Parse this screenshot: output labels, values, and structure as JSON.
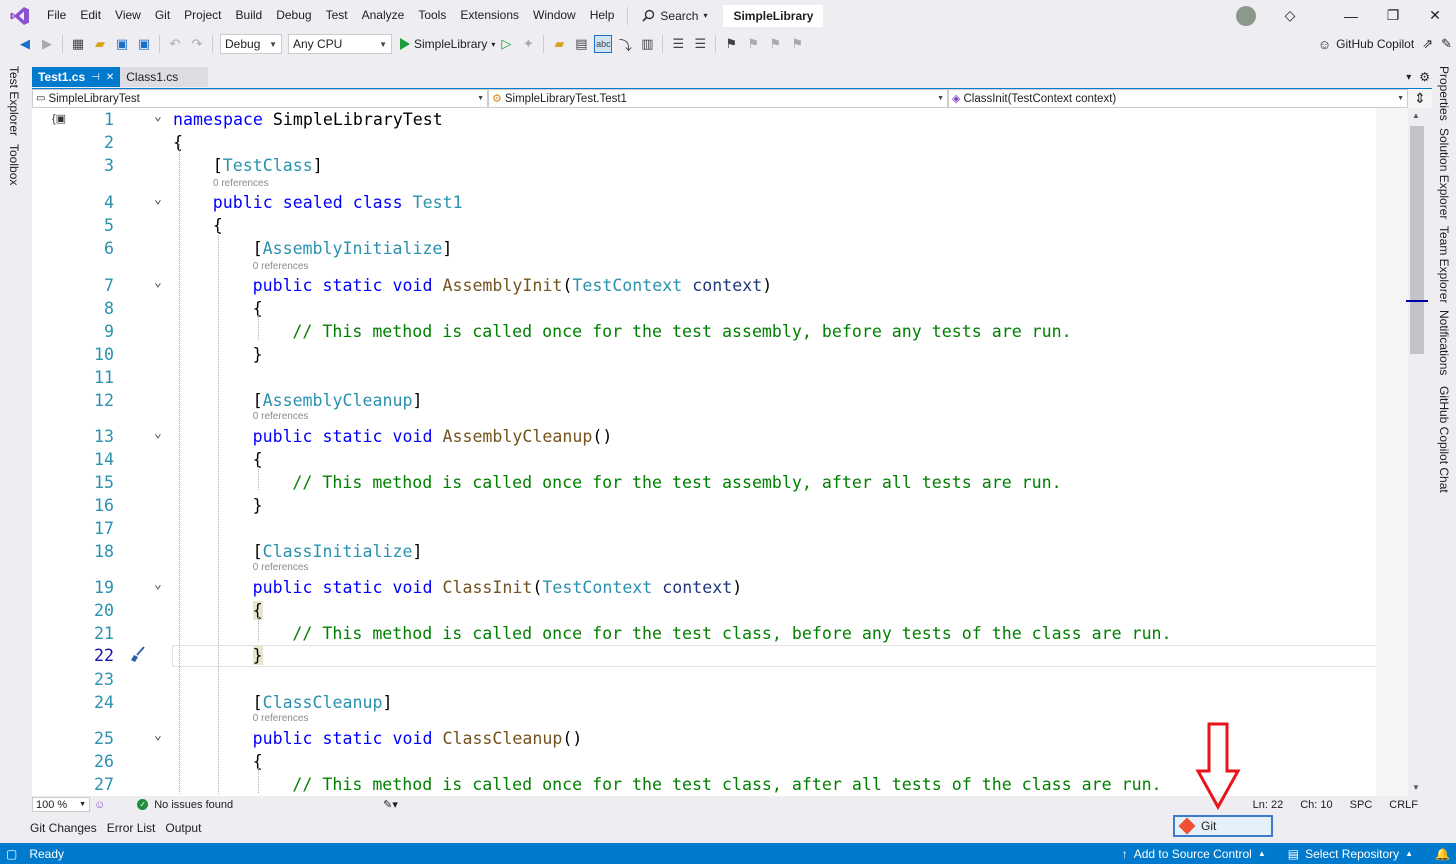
{
  "menubar": {
    "items": [
      "File",
      "Edit",
      "View",
      "Git",
      "Project",
      "Build",
      "Debug",
      "Test",
      "Analyze",
      "Tools",
      "Extensions",
      "Window",
      "Help"
    ],
    "search_label": "Search",
    "solution_name": "SimpleLibrary"
  },
  "toolbar": {
    "configuration": "Debug",
    "platform": "Any CPU",
    "run_target": "SimpleLibrary",
    "copilot_label": "GitHub Copilot"
  },
  "left_side_tabs": [
    "Test Explorer",
    "Toolbox"
  ],
  "right_side_tabs": [
    "Properties",
    "Solution Explorer",
    "Team Explorer",
    "Notifications",
    "GitHub Copilot Chat"
  ],
  "doc_tabs": [
    {
      "label": "Test1.cs",
      "active": true
    },
    {
      "label": "Class1.cs",
      "active": false
    }
  ],
  "navbar": {
    "project": "SimpleLibraryTest",
    "type": "SimpleLibraryTest.Test1",
    "member": "ClassInit(TestContext context)"
  },
  "editor": {
    "reference_label": "0 references",
    "current_line": 22,
    "lines": [
      {
        "n": "1",
        "code": "namespace SimpleLibraryTest"
      },
      {
        "n": "2",
        "code": "{"
      },
      {
        "n": "3",
        "code": "[TestClass]"
      },
      {
        "n": "4",
        "code": "public sealed class Test1"
      },
      {
        "n": "5",
        "code": "{"
      },
      {
        "n": "6",
        "code": "[AssemblyInitialize]"
      },
      {
        "n": "7",
        "code": "public static void AssemblyInit(TestContext context)"
      },
      {
        "n": "8",
        "code": "{"
      },
      {
        "n": "9",
        "code": "// This method is called once for the test assembly, before any tests are run."
      },
      {
        "n": "10",
        "code": "}"
      },
      {
        "n": "11",
        "code": ""
      },
      {
        "n": "12",
        "code": "[AssemblyCleanup]"
      },
      {
        "n": "13",
        "code": "public static void AssemblyCleanup()"
      },
      {
        "n": "14",
        "code": "{"
      },
      {
        "n": "15",
        "code": "// This method is called once for the test assembly, after all tests are run."
      },
      {
        "n": "16",
        "code": "}"
      },
      {
        "n": "17",
        "code": ""
      },
      {
        "n": "18",
        "code": "[ClassInitialize]"
      },
      {
        "n": "19",
        "code": "public static void ClassInit(TestContext context)"
      },
      {
        "n": "20",
        "code": "{"
      },
      {
        "n": "21",
        "code": "// This method is called once for the test class, before any tests of the class are run."
      },
      {
        "n": "22",
        "code": "}"
      },
      {
        "n": "23",
        "code": ""
      },
      {
        "n": "24",
        "code": "[ClassCleanup]"
      },
      {
        "n": "25",
        "code": "public static void ClassCleanup()"
      },
      {
        "n": "26",
        "code": "{"
      },
      {
        "n": "27",
        "code": "// This method is called once for the test class, after all tests of the class are run."
      }
    ]
  },
  "editor_status": {
    "zoom": "100 %",
    "issues": "No issues found",
    "line": "Ln: 22",
    "column": "Ch: 10",
    "whitespace": "SPC",
    "line_ending": "CRLF"
  },
  "bottom_tabs": [
    "Git Changes",
    "Error List",
    "Output"
  ],
  "git_popup": {
    "label": "Git"
  },
  "statusbar": {
    "ready": "Ready",
    "add_source_control": "Add to Source Control",
    "select_repository": "Select Repository"
  },
  "colors": {
    "accent": "#007acc",
    "keyword": "#0000ff",
    "type": "#2b91af",
    "comment": "#008000",
    "annotation_arrow": "#e8141b"
  }
}
